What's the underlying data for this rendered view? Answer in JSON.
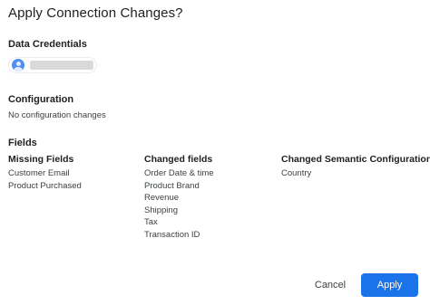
{
  "dialog": {
    "title": "Apply Connection Changes?"
  },
  "data_credentials": {
    "heading": "Data Credentials",
    "account_avatar_icon": "account-circle-icon",
    "account_name_redacted": true
  },
  "configuration": {
    "heading": "Configuration",
    "status": "No configuration changes"
  },
  "fields": {
    "heading": "Fields",
    "missing": {
      "header": "Missing Fields",
      "items": [
        "Customer Email",
        "Product Purchased"
      ]
    },
    "changed": {
      "header": "Changed fields",
      "items": [
        "Order Date & time",
        "Product Brand",
        "Revenue",
        "Shipping",
        "Tax",
        "Transaction ID"
      ]
    },
    "semantic": {
      "header": "Changed Semantic Configuration",
      "items": [
        "Country"
      ]
    }
  },
  "actions": {
    "cancel_label": "Cancel",
    "apply_label": "Apply"
  },
  "colors": {
    "primary": "#1a73e8",
    "avatar": "#4f8ef7",
    "text": "#202124",
    "secondary_text": "#3c4043"
  }
}
